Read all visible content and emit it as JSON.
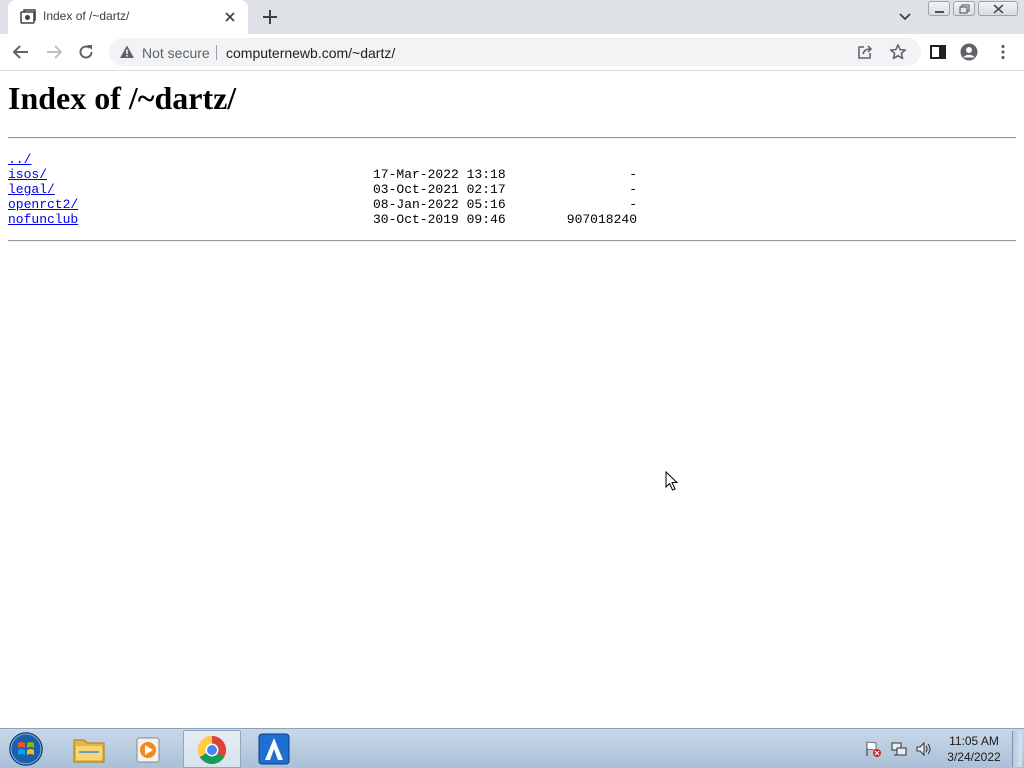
{
  "browser": {
    "tab": {
      "title": "Index of /~dartz/"
    },
    "address_bar": {
      "security_label": "Not secure",
      "url": "computernewb.com/~dartz/"
    }
  },
  "page": {
    "heading": "Index of /~dartz/",
    "entries": [
      {
        "name": "../",
        "date": "",
        "size": ""
      },
      {
        "name": "isos/",
        "date": "17-Mar-2022 13:18",
        "size": "-"
      },
      {
        "name": "legal/",
        "date": "03-Oct-2021 02:17",
        "size": "-"
      },
      {
        "name": "openrct2/",
        "date": "08-Jan-2022 05:16",
        "size": "-"
      },
      {
        "name": "nofunclub",
        "date": "30-Oct-2019 09:46",
        "size": "907018240"
      }
    ]
  },
  "taskbar": {
    "apps": [
      "file-explorer-icon",
      "media-player-icon",
      "chrome-icon",
      "app-a-icon"
    ],
    "clock": {
      "time": "11:05 AM",
      "date": "3/24/2022"
    }
  },
  "colors": {
    "link": "#0000ee",
    "tabstrip": "#dee1e6",
    "omnibox": "#f1f3f4"
  }
}
